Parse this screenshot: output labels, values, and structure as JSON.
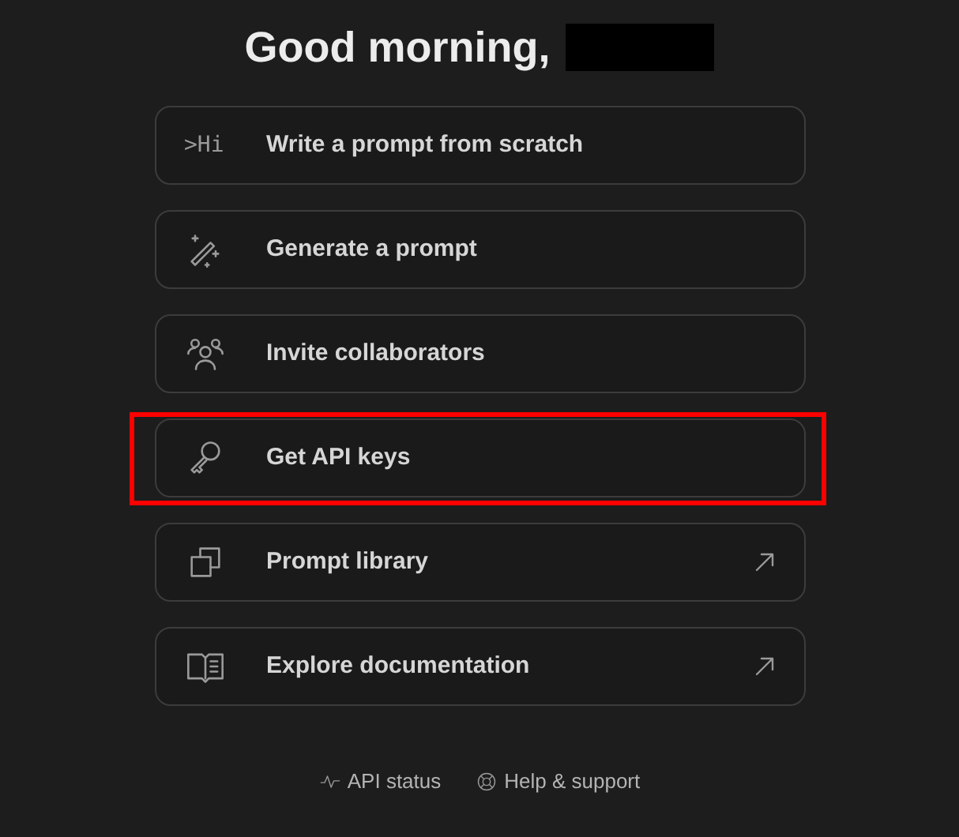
{
  "greeting": {
    "text": "Good morning,",
    "name_redacted": true
  },
  "actions": [
    {
      "label": "Write a prompt from scratch",
      "kind": "text",
      "icon_text": ">Hi",
      "external": false,
      "highlighted": false
    },
    {
      "label": "Generate a prompt",
      "kind": "wand",
      "external": false,
      "highlighted": false
    },
    {
      "label": "Invite collaborators",
      "kind": "people",
      "external": false,
      "highlighted": false
    },
    {
      "label": "Get API keys",
      "kind": "key",
      "external": false,
      "highlighted": true
    },
    {
      "label": "Prompt library",
      "kind": "copies",
      "external": true,
      "highlighted": false
    },
    {
      "label": "Explore documentation",
      "kind": "book",
      "external": true,
      "highlighted": false
    }
  ],
  "footer_links": [
    {
      "label": "API status",
      "kind": "pulse"
    },
    {
      "label": "Help & support",
      "kind": "lifebuoy"
    }
  ]
}
